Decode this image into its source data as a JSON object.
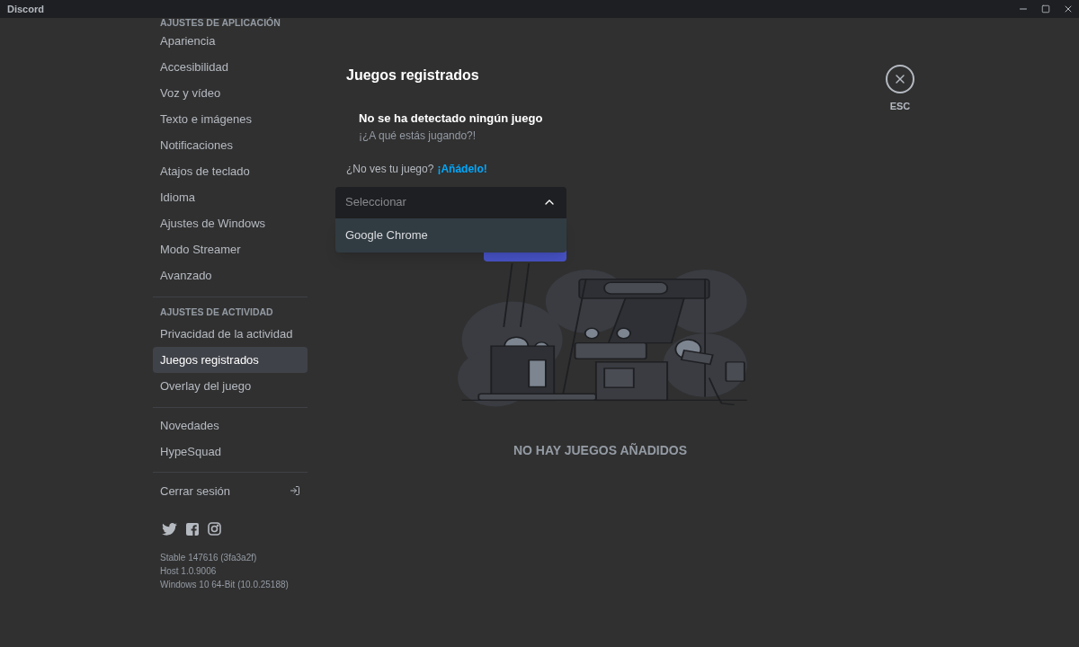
{
  "window": {
    "title": "Discord"
  },
  "sidebar": {
    "sections": [
      {
        "header": "AJUSTES DE APLICACIÓN",
        "items": [
          {
            "label": "Apariencia",
            "selected": false
          },
          {
            "label": "Accesibilidad",
            "selected": false
          },
          {
            "label": "Voz y vídeo",
            "selected": false
          },
          {
            "label": "Texto e imágenes",
            "selected": false
          },
          {
            "label": "Notificaciones",
            "selected": false
          },
          {
            "label": "Atajos de teclado",
            "selected": false
          },
          {
            "label": "Idioma",
            "selected": false
          },
          {
            "label": "Ajustes de Windows",
            "selected": false
          },
          {
            "label": "Modo Streamer",
            "selected": false
          },
          {
            "label": "Avanzado",
            "selected": false
          }
        ]
      },
      {
        "header": "AJUSTES DE ACTIVIDAD",
        "items": [
          {
            "label": "Privacidad de la actividad",
            "selected": false
          },
          {
            "label": "Juegos registrados",
            "selected": true
          },
          {
            "label": "Overlay del juego",
            "selected": false
          }
        ]
      },
      {
        "items": [
          {
            "label": "Novedades",
            "selected": false
          },
          {
            "label": "HypeSquad",
            "selected": false
          }
        ]
      }
    ],
    "logout": {
      "label": "Cerrar sesión"
    },
    "version_info": [
      "Stable 147616 (3fa3a2f)",
      "Host 1.0.9006",
      "Windows 10 64-Bit (10.0.25188)"
    ]
  },
  "close_button": {
    "label": "ESC"
  },
  "main": {
    "title": "Juegos registrados",
    "detected": {
      "title": "No se ha detectado ningún juego",
      "subtitle": "¡¿A qué estás jugando?!"
    },
    "add_prompt": {
      "text": "¿No ves tu juego?",
      "link": "¡Añádelo!"
    },
    "game_select": {
      "placeholder": "Seleccionar",
      "expanded": true,
      "options": [
        "Google Chrome"
      ]
    },
    "empty_message": "NO HAY JUEGOS AÑADIDOS"
  }
}
